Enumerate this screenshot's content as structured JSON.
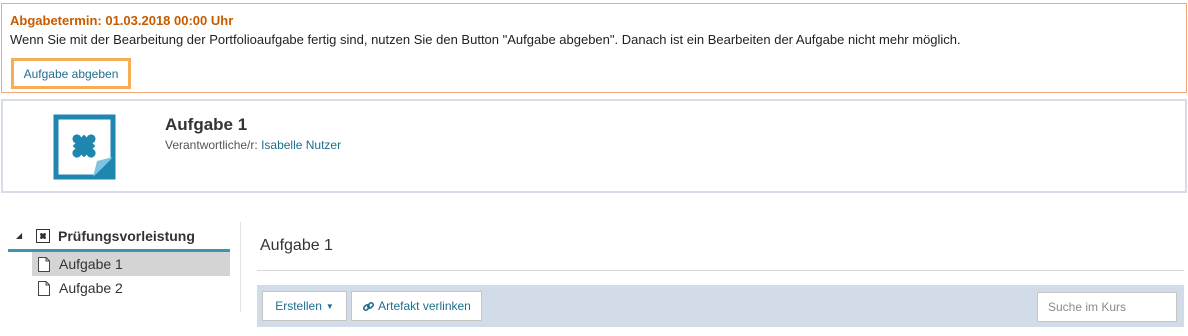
{
  "alert": {
    "title": "Abgabetermin: 01.03.2018 00:00 Uhr",
    "text": "Wenn Sie mit der Bearbeitung der Portfolioaufgabe fertig sind, nutzen Sie den Button \"Aufgabe abgeben\". Danach ist ein Bearbeiten der Aufgabe nicht mehr möglich.",
    "button_label": "Aufgabe abgeben"
  },
  "header": {
    "title": "Aufgabe 1",
    "responsible_label": "Verantwortliche/r:",
    "responsible_name": "Isabelle Nutzer",
    "icon": "puzzle-icon"
  },
  "tree": {
    "root_label": "Prüfungsvorleistung",
    "root_icon": "puzzle-icon",
    "items": [
      {
        "label": "Aufgabe 1",
        "active": true
      },
      {
        "label": "Aufgabe 2",
        "active": false
      }
    ]
  },
  "content": {
    "title": "Aufgabe 1",
    "toolbar": {
      "create_label": "Erstellen",
      "link_label": "Artefakt verlinken",
      "search_placeholder": "Suche im Kurs"
    }
  },
  "colors": {
    "accent": "#1f6e8c",
    "alert_title": "#c85a00",
    "alert_border": "#f0a77a",
    "button_highlight": "#f6ad55",
    "toolbar_bg": "#d2dce8"
  }
}
